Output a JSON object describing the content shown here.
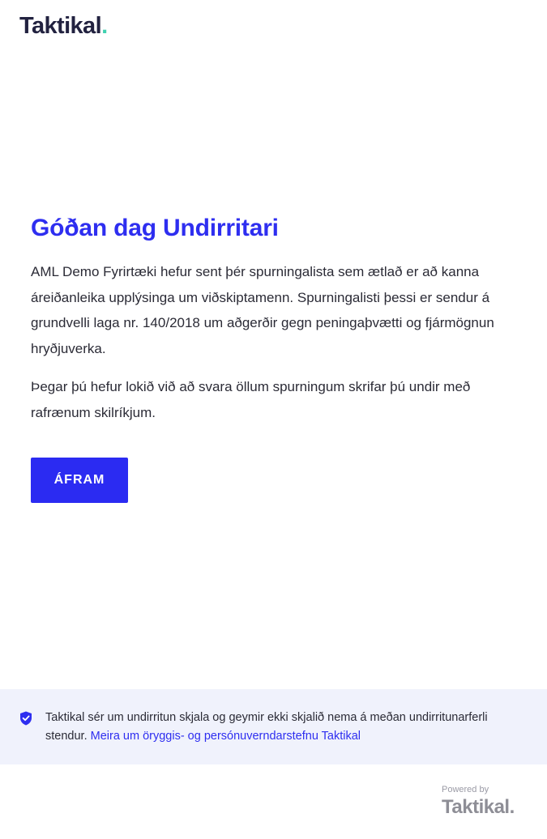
{
  "header": {
    "logo_text": "Taktikal",
    "logo_dot": "."
  },
  "main": {
    "greeting": "Góðan dag Undirritari",
    "paragraph1": "AML Demo Fyrirtæki hefur sent þér spurningalista sem ætlað er að kanna áreiðanleika upplýsinga um viðskiptamenn. Spurningalisti þessi er sendur á grundvelli laga nr. 140/2018 um aðgerðir gegn peningaþvætti og fjármögnun hryðjuverka.",
    "paragraph2": "Þegar þú hefur lokið við að svara öllum spurningum skrifar þú undir með rafrænum skilríkjum.",
    "continue_label": "ÁFRAM"
  },
  "info_banner": {
    "icon": "shield-check-icon",
    "text": "Taktikal sér um undirritun skjala og geymir ekki skjalið nema á meðan undirritunarferli stendur. ",
    "link_text": "Meira um öryggis- og persónuverndarstefnu Taktikal"
  },
  "footer": {
    "powered_by": "Powered by",
    "logo_text": "Taktikal",
    "logo_dot": "."
  },
  "colors": {
    "accent": "#2e2ef0",
    "button": "#2b2bf2",
    "logo_dot": "#3fd1b0",
    "banner_bg": "#f0f2fc"
  }
}
